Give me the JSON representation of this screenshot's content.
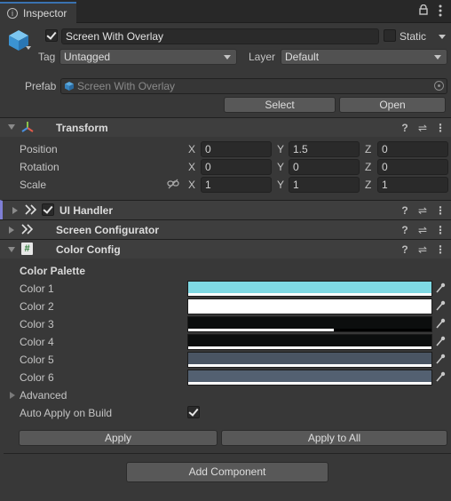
{
  "window": {
    "tab_label": "Inspector"
  },
  "object": {
    "name": "Screen With Overlay",
    "static_label": "Static",
    "tag_label": "Tag",
    "tag_value": "Untagged",
    "layer_label": "Layer",
    "layer_value": "Default",
    "prefab_label": "Prefab",
    "prefab_value": "Screen With Overlay",
    "select_label": "Select",
    "open_label": "Open"
  },
  "transform": {
    "title": "Transform",
    "rows": [
      {
        "label": "Position",
        "x": "0",
        "y": "1.5",
        "z": "0"
      },
      {
        "label": "Rotation",
        "x": "0",
        "y": "0",
        "z": "0"
      },
      {
        "label": "Scale",
        "x": "1",
        "y": "1",
        "z": "1"
      }
    ],
    "axis": {
      "x": "X",
      "y": "Y",
      "z": "Z"
    }
  },
  "components": {
    "ui_handler": "UI Handler",
    "screen_configurator": "Screen Configurator",
    "color_config": "Color Config"
  },
  "color_config": {
    "palette_header": "Color Palette",
    "colors": [
      {
        "label": "Color 1",
        "hex": "#7fd9e3",
        "alpha": 1.0
      },
      {
        "label": "Color 2",
        "hex": "#ffffff",
        "alpha": 1.0
      },
      {
        "label": "Color 3",
        "hex": "#0c0e0e",
        "alpha": 0.6
      },
      {
        "label": "Color 4",
        "hex": "#0c0e0e",
        "alpha": 1.0
      },
      {
        "label": "Color 5",
        "hex": "#4a5563",
        "alpha": 1.0
      },
      {
        "label": "Color 6",
        "hex": "#536071",
        "alpha": 1.0
      }
    ],
    "advanced_label": "Advanced",
    "auto_apply_label": "Auto Apply on Build",
    "auto_apply_checked": true,
    "apply_label": "Apply",
    "apply_all_label": "Apply to All"
  },
  "add_component_label": "Add Component"
}
